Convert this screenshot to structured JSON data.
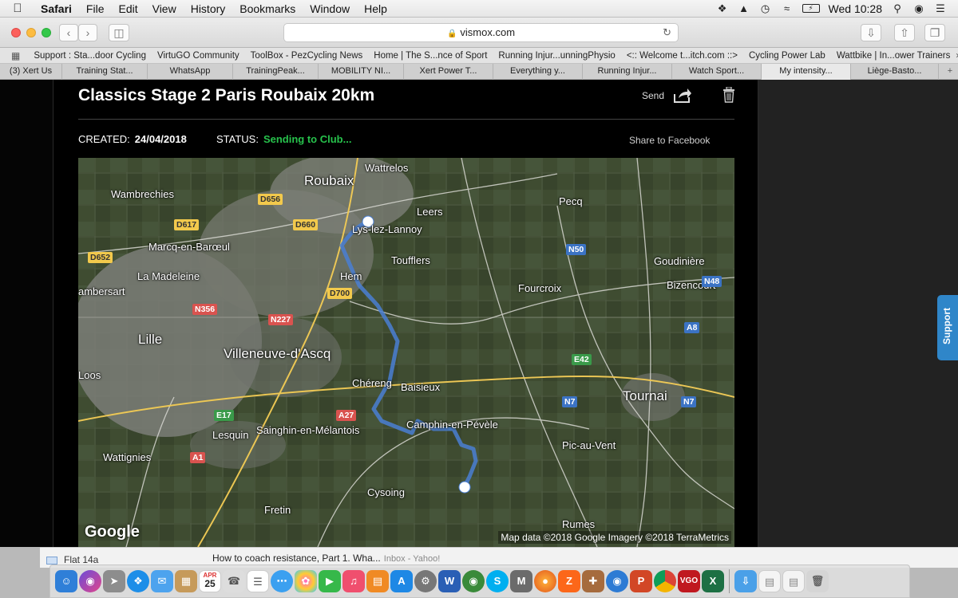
{
  "menubar": {
    "app_name": "Safari",
    "menus": [
      "File",
      "Edit",
      "View",
      "History",
      "Bookmarks",
      "Window",
      "Help"
    ],
    "clock": "Wed 10:28"
  },
  "toolbar": {
    "url": "vismox.com"
  },
  "bookmarks": [
    "Support : Sta...door Cycling",
    "VirtuGO Community",
    "ToolBox - PezCycling News",
    "Home | The S...nce of Sport",
    "Running Injur...unningPhysio",
    "<:: Welcome t...itch.com ::>",
    "Cycling Power Lab",
    "Wattbike | In...ower Trainers"
  ],
  "tabs": [
    "(3) Xert Us",
    "Training Stat...",
    "WhatsApp",
    "TrainingPeak...",
    "MOBILITY NI...",
    "Xert Power T...",
    "Everything y...",
    "Running Injur...",
    "Watch Sport...",
    "My intensity...",
    "Liège-Basto..."
  ],
  "active_tab_index": 9,
  "card": {
    "title": "Classics Stage 2 Paris Roubaix 20km",
    "send_label": "Send",
    "created_label": "CREATED:",
    "created_value": "24/04/2018",
    "status_label": "STATUS:",
    "status_value": "Sending to Club...",
    "share_facebook": "Share to Facebook",
    "status_color": "#27c24c"
  },
  "map": {
    "places": {
      "wattrelos": "Wattrelos",
      "roubaix": "Roubaix",
      "wambrechies": "Wambrechies",
      "leers": "Leers",
      "pecq": "Pecq",
      "lys_lez_lannoy": "Lys-lez-Lannoy",
      "marcq": "Marcq-en-Barœul",
      "toufflers": "Toufflers",
      "goudiniere": "Goudinière",
      "la_madeleine": "La Madeleine",
      "hem": "Hem",
      "lambersart": "ambersart",
      "bizencourt": "Bizencourt",
      "fourcroix": "Fourcroix",
      "lille": "Lille",
      "villeneuve": "Villeneuve-d'Ascq",
      "loos": "Loos",
      "cherong": "Chéreng",
      "baisieux": "Baisieux",
      "tournai": "Tournai",
      "lesquin": "Lesquin",
      "sainghin": "Sainghin-en-Mélantois",
      "camphin": "Camphin-en-Pévèle",
      "pic_au_vent": "Pic-au-Vent",
      "wattignies": "Wattignies",
      "cysoing": "Cysoing",
      "fretin": "Fretin",
      "rumes": "Rumes"
    },
    "roads": {
      "d656": "D656",
      "d617": "D617",
      "d660": "D660",
      "d652": "D652",
      "d700": "D700",
      "n356": "N356",
      "n227": "N227",
      "n50": "N50",
      "n48": "N48",
      "a8": "A8",
      "e42": "E42",
      "n7a": "N7",
      "n7b": "N7",
      "a27": "A27",
      "e17": "E17",
      "a1": "A1"
    },
    "google_logo": "Google",
    "attribution": "Map data ©2018 Google  Imagery ©2018 TerraMetrics",
    "route_color": "#4a7fd4"
  },
  "support_label": "Support",
  "behind": {
    "folder": "Flat 14a",
    "mail_subject": "How to coach resistance, Part 1. Wha...",
    "mail_inbox": "Inbox - Yahoo!"
  },
  "dock": {
    "icons": [
      "finder-icon",
      "siri-icon",
      "launchpad-icon",
      "safari-icon",
      "mail-icon",
      "notes-icon",
      "calendar-icon",
      "contacts-icon",
      "reminders-icon",
      "messages-icon",
      "photos-icon",
      "facetime-icon",
      "music-icon",
      "books-icon",
      "appstore-icon",
      "preferences-icon",
      "word-icon",
      "earth-icon",
      "skype-icon",
      "m-icon",
      "firefox-icon",
      "zwift-icon",
      "cross-icon",
      "powerpoint-icon",
      "chrome-icon",
      "vgo-icon",
      "excel-icon",
      "downloads-icon",
      "document-icon",
      "document2-icon",
      "trash-icon"
    ],
    "calendar_month": "APR",
    "calendar_day": "25",
    "vgo_label": "VGO",
    "word_label": "W",
    "excel_label": "X",
    "m_label": "M",
    "z_label": "Z",
    "p_label": "P"
  }
}
